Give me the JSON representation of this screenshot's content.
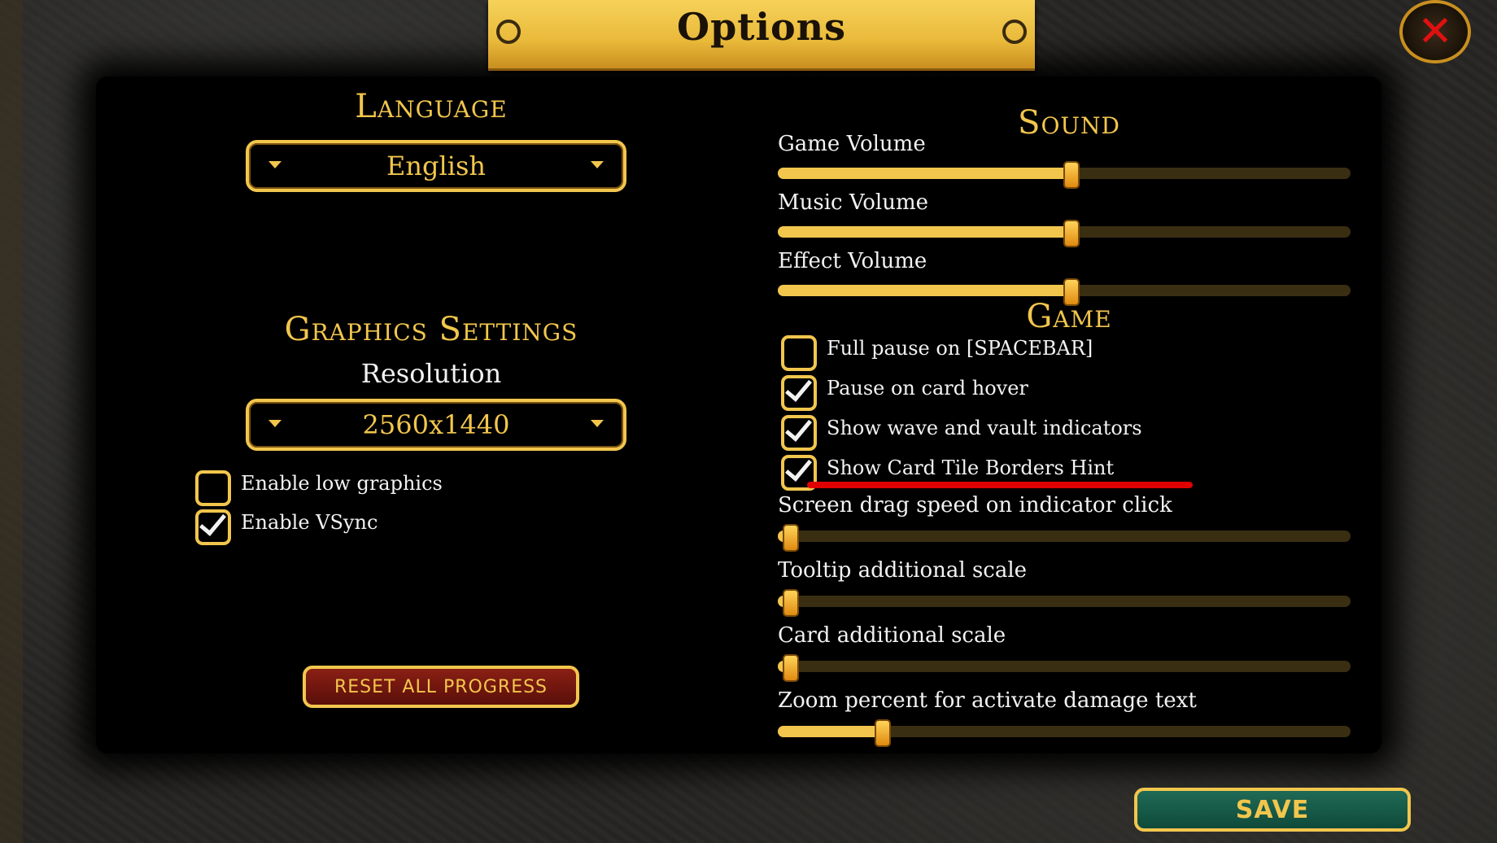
{
  "window": {
    "title": "Options"
  },
  "close_label": "✕",
  "language": {
    "title": "Language",
    "selected": "English"
  },
  "graphics": {
    "title": "Graphics Settings",
    "resolution_label": "Resolution",
    "resolution_value": "2560x1440",
    "options": [
      {
        "label": "Enable low graphics",
        "checked": false
      },
      {
        "label": "Enable VSync",
        "checked": true
      }
    ]
  },
  "sound": {
    "title": "Sound",
    "sliders": [
      {
        "label": "Game Volume",
        "value_pct": 51
      },
      {
        "label": "Music Volume",
        "value_pct": 51
      },
      {
        "label": "Effect Volume",
        "value_pct": 51
      }
    ]
  },
  "game": {
    "title": "Game",
    "options": [
      {
        "label": "Full pause on [SPACEBAR]",
        "checked": false
      },
      {
        "label": "Pause on card hover",
        "checked": true
      },
      {
        "label": "Show wave and vault indicators",
        "checked": true
      },
      {
        "label": "Show Card Tile Borders Hint",
        "checked": true
      }
    ],
    "sliders": [
      {
        "label": "Screen drag speed on indicator click",
        "value_pct": 2
      },
      {
        "label": "Tooltip additional scale",
        "value_pct": 2
      },
      {
        "label": "Card additional scale",
        "value_pct": 2
      },
      {
        "label": "Zoom percent for activate damage text",
        "value_pct": 18
      }
    ]
  },
  "buttons": {
    "reset": "RESET ALL PROGRESS",
    "save": "SAVE"
  },
  "colors": {
    "accent_gold": "#f2c64d",
    "reset_red": "#8a1f14",
    "save_green": "#1f6a56",
    "close_red": "#e01010"
  }
}
